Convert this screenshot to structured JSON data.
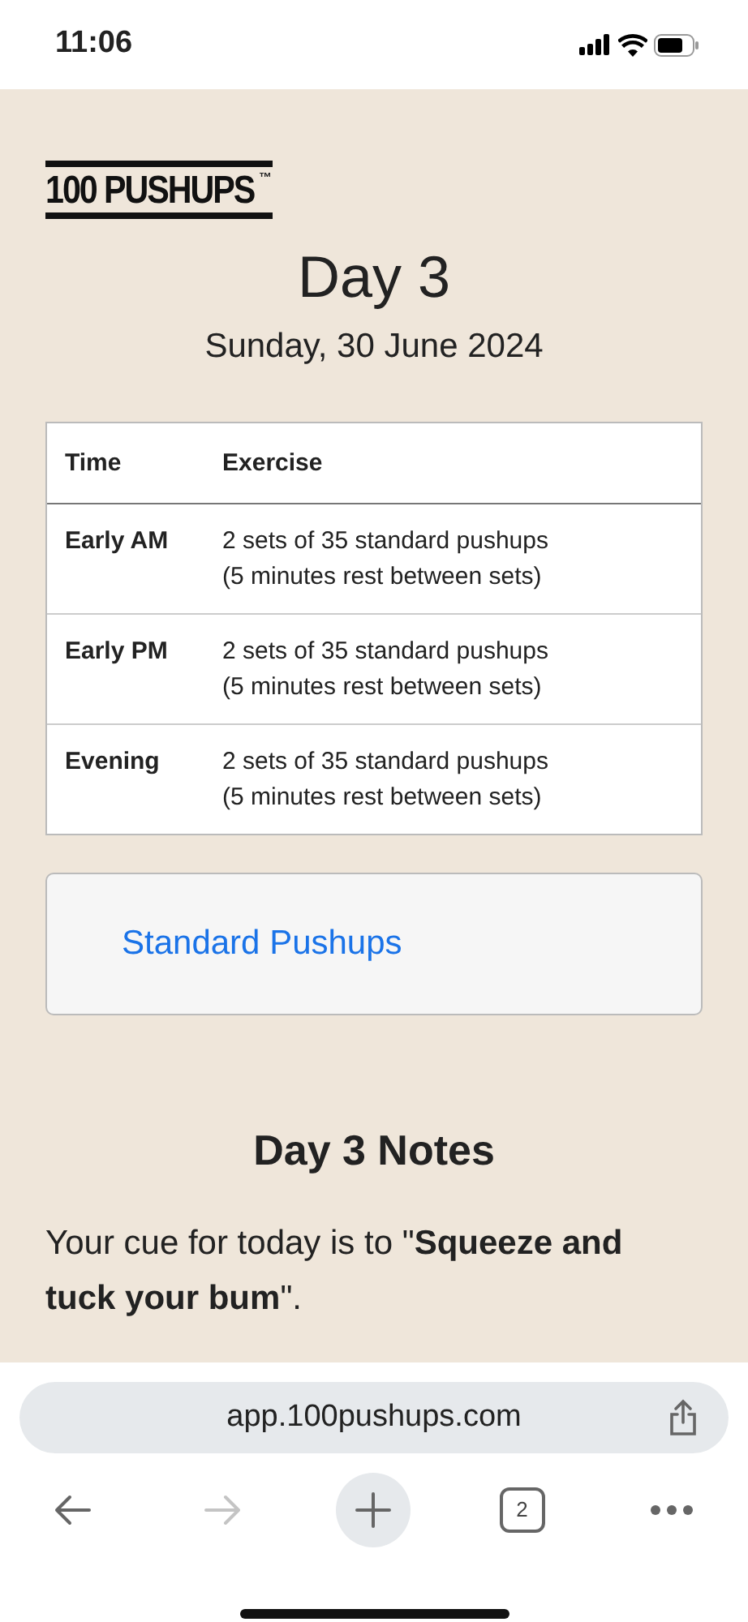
{
  "status_bar": {
    "time": "11:06"
  },
  "logo": {
    "text": "100 PUSHUPS",
    "mark": "™"
  },
  "heading": "Day 3",
  "date": "Sunday, 30 June 2024",
  "table": {
    "columns": [
      "Time",
      "Exercise"
    ],
    "rows": [
      {
        "time": "Early AM",
        "exercise": [
          "2 sets of 35 standard pushups",
          "(5 minutes rest between sets)"
        ]
      },
      {
        "time": "Early PM",
        "exercise": [
          "2 sets of 35 standard pushups",
          "(5 minutes rest between sets)"
        ]
      },
      {
        "time": "Evening",
        "exercise": [
          "2 sets of 35 standard pushups",
          "(5 minutes rest between sets)"
        ]
      }
    ]
  },
  "link_card": {
    "link": "Standard Pushups"
  },
  "notes": {
    "title": "Day 3 Notes",
    "text": "Your cue for today is to \"**Squeeze and tuck your bum**\"."
  },
  "browser": {
    "url": "app.100pushups.com",
    "toolbar": [
      {
        "kind": "back",
        "disabled": false
      },
      {
        "kind": "forward",
        "disabled": true
      },
      {
        "kind": "new-tab",
        "disabled": false
      },
      {
        "kind": "tabs",
        "label": "2",
        "disabled": false
      },
      {
        "kind": "more",
        "disabled": false
      }
    ]
  }
}
